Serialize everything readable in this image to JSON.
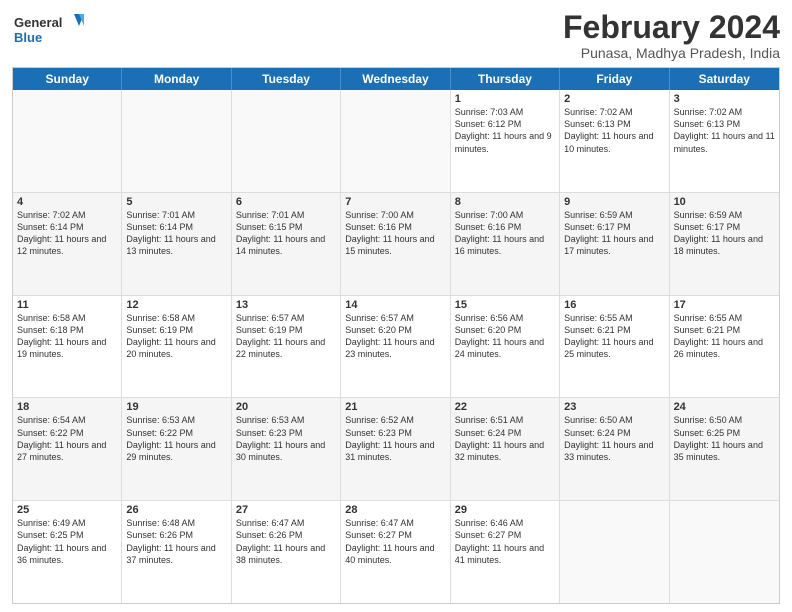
{
  "logo": {
    "line1": "General",
    "line2": "Blue"
  },
  "title": "February 2024",
  "location": "Punasa, Madhya Pradesh, India",
  "days_of_week": [
    "Sunday",
    "Monday",
    "Tuesday",
    "Wednesday",
    "Thursday",
    "Friday",
    "Saturday"
  ],
  "weeks": [
    [
      {
        "day": "",
        "info": ""
      },
      {
        "day": "",
        "info": ""
      },
      {
        "day": "",
        "info": ""
      },
      {
        "day": "",
        "info": ""
      },
      {
        "day": "1",
        "info": "Sunrise: 7:03 AM\nSunset: 6:12 PM\nDaylight: 11 hours and 9 minutes."
      },
      {
        "day": "2",
        "info": "Sunrise: 7:02 AM\nSunset: 6:13 PM\nDaylight: 11 hours and 10 minutes."
      },
      {
        "day": "3",
        "info": "Sunrise: 7:02 AM\nSunset: 6:13 PM\nDaylight: 11 hours and 11 minutes."
      }
    ],
    [
      {
        "day": "4",
        "info": "Sunrise: 7:02 AM\nSunset: 6:14 PM\nDaylight: 11 hours and 12 minutes."
      },
      {
        "day": "5",
        "info": "Sunrise: 7:01 AM\nSunset: 6:14 PM\nDaylight: 11 hours and 13 minutes."
      },
      {
        "day": "6",
        "info": "Sunrise: 7:01 AM\nSunset: 6:15 PM\nDaylight: 11 hours and 14 minutes."
      },
      {
        "day": "7",
        "info": "Sunrise: 7:00 AM\nSunset: 6:16 PM\nDaylight: 11 hours and 15 minutes."
      },
      {
        "day": "8",
        "info": "Sunrise: 7:00 AM\nSunset: 6:16 PM\nDaylight: 11 hours and 16 minutes."
      },
      {
        "day": "9",
        "info": "Sunrise: 6:59 AM\nSunset: 6:17 PM\nDaylight: 11 hours and 17 minutes."
      },
      {
        "day": "10",
        "info": "Sunrise: 6:59 AM\nSunset: 6:17 PM\nDaylight: 11 hours and 18 minutes."
      }
    ],
    [
      {
        "day": "11",
        "info": "Sunrise: 6:58 AM\nSunset: 6:18 PM\nDaylight: 11 hours and 19 minutes."
      },
      {
        "day": "12",
        "info": "Sunrise: 6:58 AM\nSunset: 6:19 PM\nDaylight: 11 hours and 20 minutes."
      },
      {
        "day": "13",
        "info": "Sunrise: 6:57 AM\nSunset: 6:19 PM\nDaylight: 11 hours and 22 minutes."
      },
      {
        "day": "14",
        "info": "Sunrise: 6:57 AM\nSunset: 6:20 PM\nDaylight: 11 hours and 23 minutes."
      },
      {
        "day": "15",
        "info": "Sunrise: 6:56 AM\nSunset: 6:20 PM\nDaylight: 11 hours and 24 minutes."
      },
      {
        "day": "16",
        "info": "Sunrise: 6:55 AM\nSunset: 6:21 PM\nDaylight: 11 hours and 25 minutes."
      },
      {
        "day": "17",
        "info": "Sunrise: 6:55 AM\nSunset: 6:21 PM\nDaylight: 11 hours and 26 minutes."
      }
    ],
    [
      {
        "day": "18",
        "info": "Sunrise: 6:54 AM\nSunset: 6:22 PM\nDaylight: 11 hours and 27 minutes."
      },
      {
        "day": "19",
        "info": "Sunrise: 6:53 AM\nSunset: 6:22 PM\nDaylight: 11 hours and 29 minutes."
      },
      {
        "day": "20",
        "info": "Sunrise: 6:53 AM\nSunset: 6:23 PM\nDaylight: 11 hours and 30 minutes."
      },
      {
        "day": "21",
        "info": "Sunrise: 6:52 AM\nSunset: 6:23 PM\nDaylight: 11 hours and 31 minutes."
      },
      {
        "day": "22",
        "info": "Sunrise: 6:51 AM\nSunset: 6:24 PM\nDaylight: 11 hours and 32 minutes."
      },
      {
        "day": "23",
        "info": "Sunrise: 6:50 AM\nSunset: 6:24 PM\nDaylight: 11 hours and 33 minutes."
      },
      {
        "day": "24",
        "info": "Sunrise: 6:50 AM\nSunset: 6:25 PM\nDaylight: 11 hours and 35 minutes."
      }
    ],
    [
      {
        "day": "25",
        "info": "Sunrise: 6:49 AM\nSunset: 6:25 PM\nDaylight: 11 hours and 36 minutes."
      },
      {
        "day": "26",
        "info": "Sunrise: 6:48 AM\nSunset: 6:26 PM\nDaylight: 11 hours and 37 minutes."
      },
      {
        "day": "27",
        "info": "Sunrise: 6:47 AM\nSunset: 6:26 PM\nDaylight: 11 hours and 38 minutes."
      },
      {
        "day": "28",
        "info": "Sunrise: 6:47 AM\nSunset: 6:27 PM\nDaylight: 11 hours and 40 minutes."
      },
      {
        "day": "29",
        "info": "Sunrise: 6:46 AM\nSunset: 6:27 PM\nDaylight: 11 hours and 41 minutes."
      },
      {
        "day": "",
        "info": ""
      },
      {
        "day": "",
        "info": ""
      }
    ]
  ]
}
